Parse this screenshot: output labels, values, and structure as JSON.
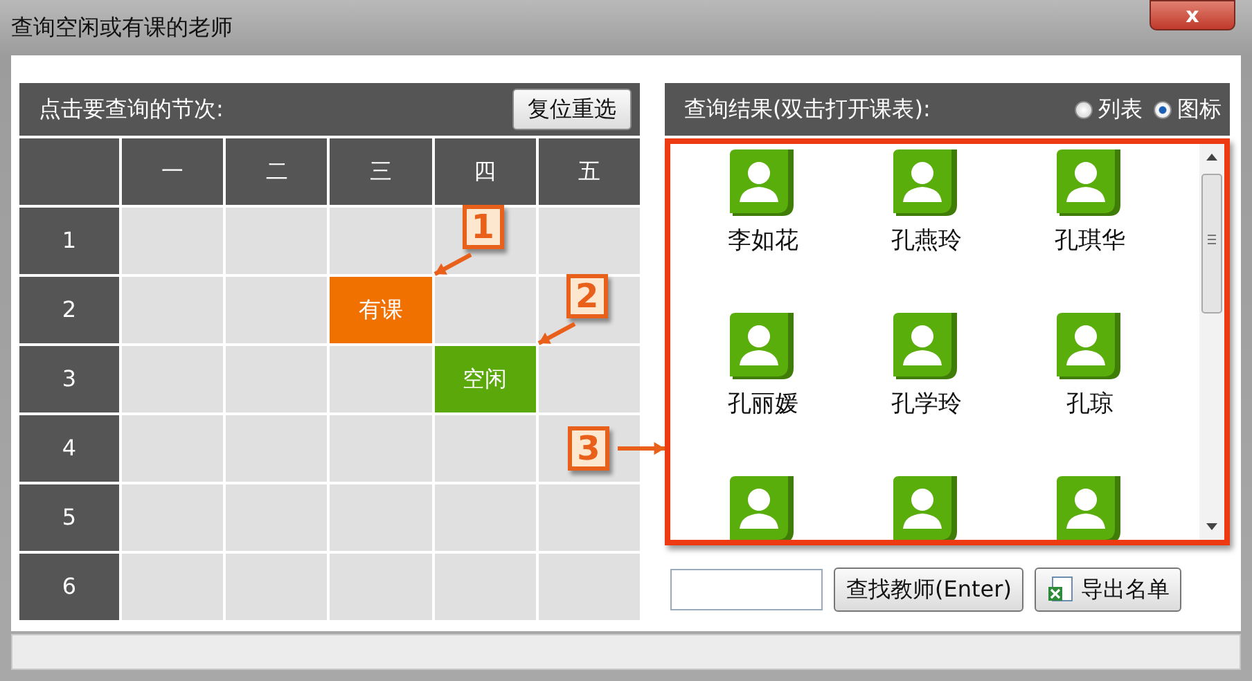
{
  "window": {
    "title": "查询空闲或有课的老师",
    "close": "x"
  },
  "periods_panel": {
    "header": "点击要查询的节次:",
    "reset_button": "复位重选",
    "days": [
      "一",
      "二",
      "三",
      "四",
      "五"
    ],
    "rows": [
      {
        "label": "1",
        "cells": [
          {
            "kind": "empty"
          },
          {
            "kind": "empty"
          },
          {
            "kind": "empty"
          },
          {
            "kind": "empty"
          },
          {
            "kind": "empty"
          }
        ]
      },
      {
        "label": "2",
        "cells": [
          {
            "kind": "empty"
          },
          {
            "kind": "empty"
          },
          {
            "kind": "busy",
            "text": "有课",
            "callout": "1"
          },
          {
            "kind": "empty"
          },
          {
            "kind": "empty"
          }
        ]
      },
      {
        "label": "3",
        "cells": [
          {
            "kind": "empty"
          },
          {
            "kind": "empty"
          },
          {
            "kind": "empty"
          },
          {
            "kind": "free",
            "text": "空闲",
            "callout": "2"
          },
          {
            "kind": "empty"
          }
        ]
      },
      {
        "label": "4",
        "cells": [
          {
            "kind": "empty"
          },
          {
            "kind": "empty"
          },
          {
            "kind": "empty"
          },
          {
            "kind": "empty"
          },
          {
            "kind": "empty"
          }
        ]
      },
      {
        "label": "5",
        "cells": [
          {
            "kind": "empty"
          },
          {
            "kind": "empty"
          },
          {
            "kind": "empty"
          },
          {
            "kind": "empty"
          },
          {
            "kind": "empty"
          }
        ]
      },
      {
        "label": "6",
        "cells": [
          {
            "kind": "empty"
          },
          {
            "kind": "empty"
          },
          {
            "kind": "empty"
          },
          {
            "kind": "empty"
          },
          {
            "kind": "empty"
          }
        ]
      }
    ]
  },
  "results_panel": {
    "header": "查询结果(双击打开课表):",
    "view_options": [
      {
        "label": "列表",
        "selected": false
      },
      {
        "label": "图标",
        "selected": true
      }
    ],
    "teachers": [
      {
        "kind": "named",
        "name": "李如花"
      },
      {
        "kind": "named",
        "name": "孔燕玲"
      },
      {
        "kind": "named",
        "name": "孔琪华"
      },
      {
        "kind": "named",
        "name": "孔丽媛"
      },
      {
        "kind": "named",
        "name": "孔学玲"
      },
      {
        "kind": "named",
        "name": "孔琼"
      },
      {
        "kind": "cut"
      },
      {
        "kind": "cut"
      },
      {
        "kind": "cut"
      }
    ],
    "search_button": "查找教师(Enter)",
    "export_button": "导出名单",
    "callout": "3"
  }
}
